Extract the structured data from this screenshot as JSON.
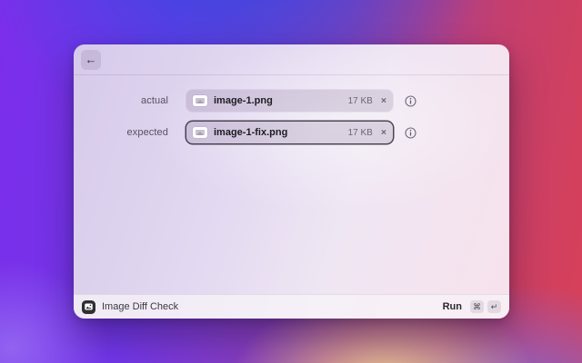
{
  "window": {
    "header": {
      "back_icon": "←"
    },
    "form": {
      "rows": [
        {
          "label": "actual",
          "file": {
            "name": "image-1.png",
            "size": "17 KB",
            "remove_icon": "×"
          }
        },
        {
          "label": "expected",
          "file": {
            "name": "image-1-fix.png",
            "size": "17 KB",
            "remove_icon": "×"
          }
        }
      ]
    },
    "footer": {
      "command_name": "Image Diff Check",
      "run_label": "Run",
      "keys": [
        "⌘",
        "↵"
      ]
    }
  },
  "colors": {
    "bg_purple": "#7c2eea",
    "bg_blue": "#3848e0",
    "bg_red": "#d84057",
    "bg_glow": "#ebc68c",
    "window_tint_left": "#d6caea",
    "window_tint_right": "#f7e2ec",
    "focus_ring": "#2d2834"
  }
}
